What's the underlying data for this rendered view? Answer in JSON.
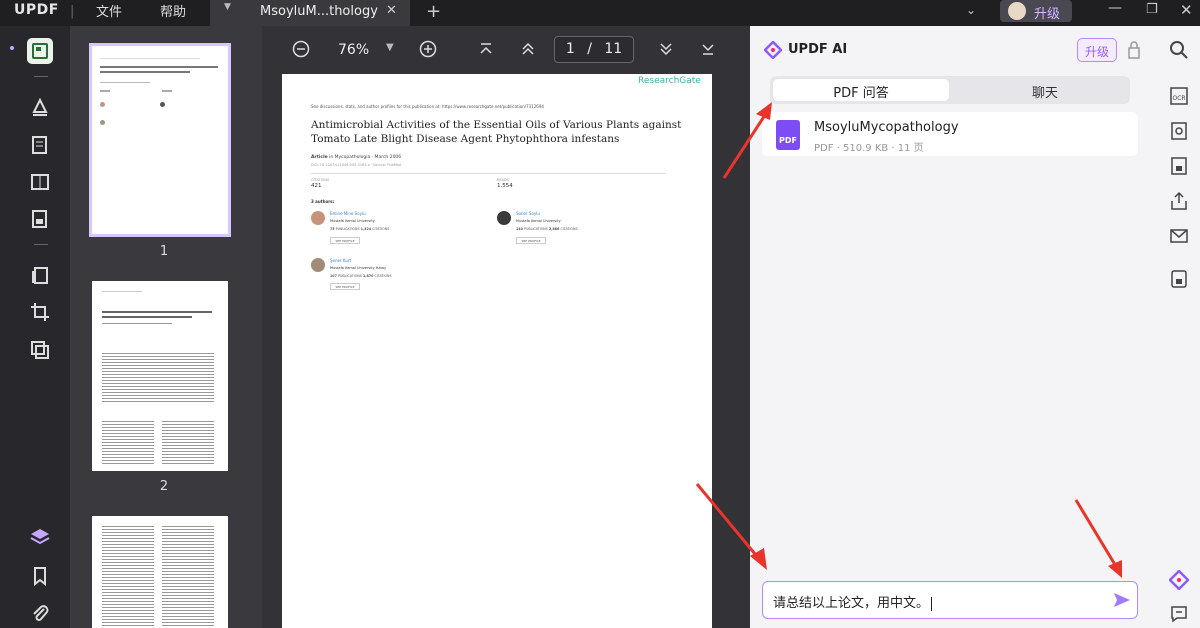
{
  "app": {
    "logo": "UPDF",
    "menu_file": "文件",
    "menu_help": "帮助"
  },
  "tab": {
    "title": "MsoyluM...thology"
  },
  "account": {
    "upgrade": "升级"
  },
  "viewer": {
    "zoom": "76%",
    "page_current": "1",
    "page_sep": "/",
    "page_total": "11"
  },
  "thumbs": {
    "p1": "1",
    "p2": "2"
  },
  "paper": {
    "watermark": "ResearchGate",
    "top_note": "See discussions, stats, and author profiles for this publication at: https://www.researchgate.net/publication/7312694",
    "title": "Antimicrobial Activities of the Essential Oils of Various Plants against Tomato Late Blight Disease Agent Phytophthora infestans",
    "meta_prefix": "Article",
    "meta_journal": "Mycopathologia · March 2006",
    "doi": "DOI: 10.1007/s11046-005-0163-z · Source: PubMed",
    "citations_label": "CITATIONS",
    "citations": "421",
    "reads_label": "READS",
    "reads": "1,554",
    "authors_label": "3 authors:",
    "authors": [
      {
        "name": "Emine Mine Soylu",
        "affil": "Mustafa Kemal University",
        "pubs": "75",
        "pubs_label": "PUBLICATIONS",
        "cites": "1,324",
        "cites_label": "CITATIONS",
        "btn": "SEE PROFILE"
      },
      {
        "name": "Soner Soylu",
        "affil": "Mustafa Kemal University",
        "pubs": "140",
        "pubs_label": "PUBLICATIONS",
        "cites": "2,886",
        "cites_label": "CITATIONS",
        "btn": "SEE PROFILE"
      },
      {
        "name": "Şener Kurt",
        "affil": "Mustafa Kemal University Hatay",
        "pubs": "107",
        "pubs_label": "PUBLICATIONS",
        "cites": "1,870",
        "cites_label": "CITATIONS",
        "btn": "SEE PROFILE"
      }
    ]
  },
  "ai": {
    "title": "UPDF AI",
    "upgrade": "升级",
    "tab_pdf_qa": "PDF 问答",
    "tab_chat": "聊天",
    "file_name": "MsoyluMycopathology",
    "file_badge": "PDF",
    "file_meta": "PDF · 510.9 KB · 11 页",
    "input_text": "请总结以上论文，用中文。"
  },
  "colors": {
    "accent": "#8a5cff",
    "arrow": "#e8342a",
    "dark_bg": "#2a2a2e",
    "panel_bg": "#f4f4f6"
  }
}
